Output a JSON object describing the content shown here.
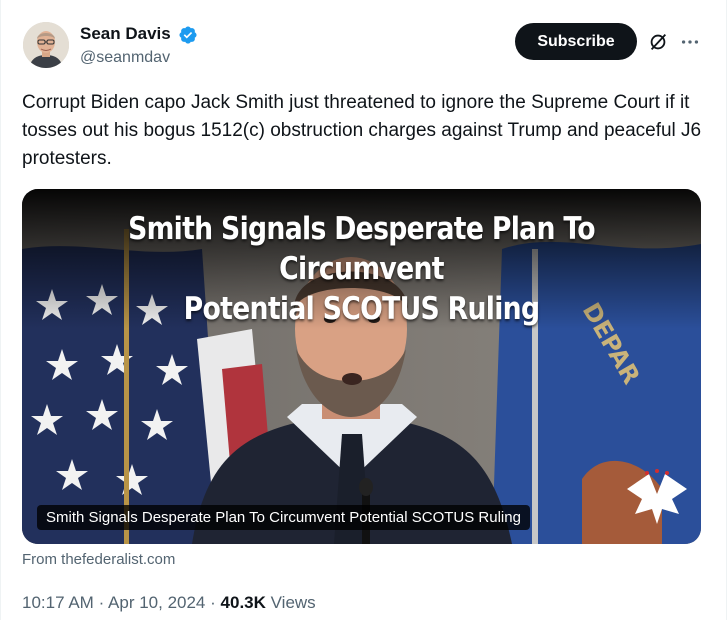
{
  "author": {
    "name": "Sean Davis",
    "handle": "@seanmdav",
    "verified_color": "#1d9bf0"
  },
  "actions": {
    "subscribe_label": "Subscribe",
    "grok_icon": "grok-icon",
    "more_icon": "more-icon"
  },
  "tweet": {
    "text": "Corrupt Biden capo Jack Smith just threatened to ignore the Supreme Court if it tosses out his bogus 1512(c) obstruction charges against Trump and peaceful J6 protesters."
  },
  "card": {
    "headline_line1": "Smith Signals Desperate Plan To Circumvent",
    "headline_line2": "Potential SCOTUS Ruling",
    "flag_lettering": "DEPAR",
    "caption": "Smith Signals Desperate Plan To Circumvent Potential SCOTUS Ruling",
    "source": "From thefederalist.com"
  },
  "meta": {
    "time": "10:17 AM",
    "separator": "·",
    "date": "Apr 10, 2024",
    "views_count": "40.3K",
    "views_label": "Views"
  },
  "colors": {
    "text_primary": "#0f1419",
    "text_secondary": "#536471",
    "button_bg": "#0f1419"
  }
}
